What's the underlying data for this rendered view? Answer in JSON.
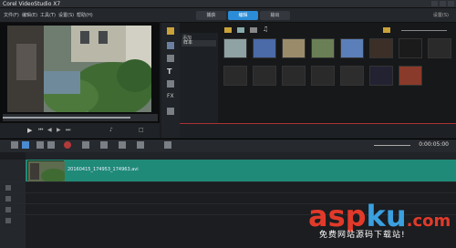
{
  "app": {
    "title": "Corel VideoStudio X7"
  },
  "menu": [
    "文件(F)",
    "编辑(E)",
    "工具(T)",
    "设置(S)",
    "帮助(H)"
  ],
  "tabs": [
    {
      "label": "捕获",
      "active": false
    },
    {
      "label": "编辑",
      "active": true
    },
    {
      "label": "输出",
      "active": false
    }
  ],
  "settings_label": "设置(S)",
  "library": {
    "folder_add": "添加",
    "selected_folder": "样本",
    "items": [
      {
        "label": "",
        "color": "#8fa2a4"
      },
      {
        "label": "",
        "color": "#4a6aa8"
      },
      {
        "label": "",
        "color": "#9a8b6a"
      },
      {
        "label": "",
        "color": "#6a7f55"
      },
      {
        "label": "",
        "color": "#5b7fb8"
      },
      {
        "label": "",
        "color": "#3b2f27"
      },
      {
        "label": "",
        "color": "#1b1b1b"
      },
      {
        "label": "",
        "color": "#2a2a2a"
      },
      {
        "label": "",
        "color": "#2a2a2a"
      },
      {
        "label": "",
        "color": "#2a2a2a"
      },
      {
        "label": "",
        "color": "#2a2a2a"
      },
      {
        "label": "",
        "color": "#2a2a2a"
      },
      {
        "label": "",
        "color": "#2d2d2d"
      },
      {
        "label": "",
        "color": "#223"
      },
      {
        "label": "",
        "color": "#8a3a2a"
      }
    ]
  },
  "timeline": {
    "clip_name": "20160415_174953_174963.avi",
    "timecode": "0:00:05:00"
  },
  "watermark": {
    "brand_a": "asp",
    "brand_b": "ku",
    "brand_c": ".com",
    "sub": "免费网站源码下载站!",
    "color_a": "#e23a2a",
    "color_b": "#3aa0e0"
  }
}
